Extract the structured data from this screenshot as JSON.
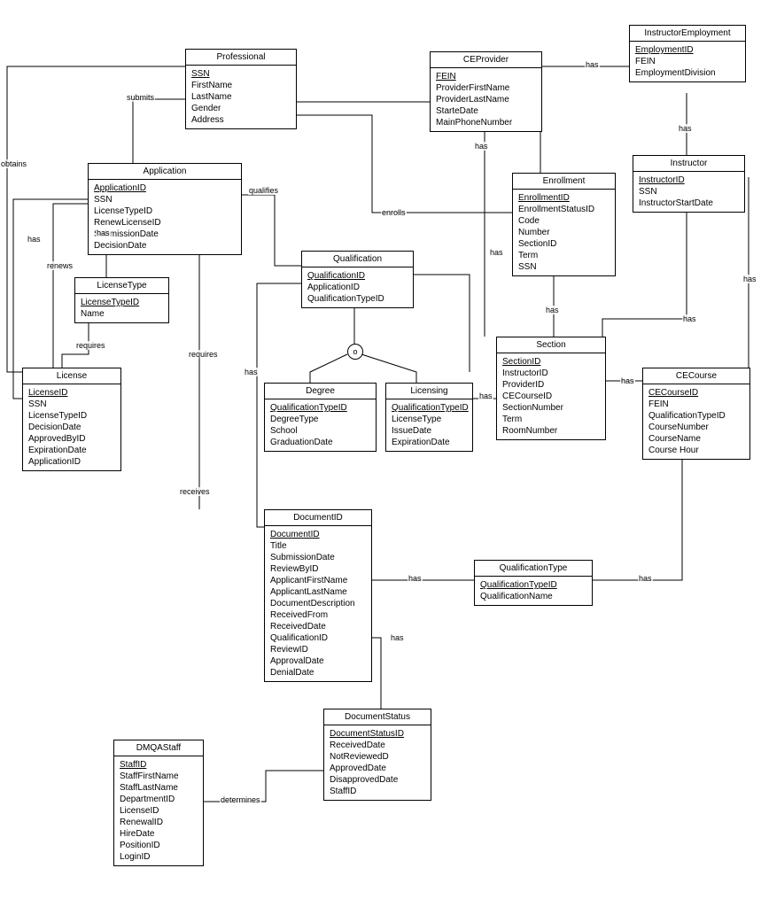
{
  "entities": {
    "professional": {
      "title": "Professional",
      "pk": "SSN",
      "attrs": [
        "FirstName",
        "LastName",
        "Gender",
        "Address"
      ]
    },
    "ceprovider": {
      "title": "CEProvider",
      "pk": "FEIN",
      "attrs": [
        "ProviderFirstName",
        "ProviderLastName",
        "StarteDate",
        "MainPhoneNumber"
      ]
    },
    "instructoremployment": {
      "title": "InstructorEmployment",
      "pk": "EmploymentID",
      "attrs": [
        "FEIN",
        "EmploymentDivision"
      ]
    },
    "application": {
      "title": "Application",
      "pk": "ApplicationID",
      "attrs": [
        "SSN",
        "LicenseTypeID",
        "RenewLicenseID",
        "SubmissionDate",
        "DecisionDate"
      ]
    },
    "enrollment": {
      "title": "Enrollment",
      "pk": "EnrollmentID",
      "attrs": [
        "EnrollmentStatusID",
        "Code",
        "Number",
        "SectionID",
        "Term",
        "SSN"
      ]
    },
    "instructor": {
      "title": "Instructor",
      "pk": "InstructorID",
      "attrs": [
        "SSN",
        "InstructorStartDate"
      ]
    },
    "licensetype": {
      "title": "LicenseType",
      "pk": "LicenseTypeID",
      "attrs": [
        "Name"
      ]
    },
    "qualification": {
      "title": "Qualification",
      "pk": "QualificationID",
      "attrs": [
        "ApplicationID",
        "QualificationTypeID"
      ]
    },
    "section": {
      "title": "Section",
      "pk": "SectionID",
      "attrs": [
        "InstructorID",
        "ProviderID",
        "CECourseID",
        "SectionNumber",
        "Term",
        "RoomNumber"
      ]
    },
    "license": {
      "title": "License",
      "pk": "LicenseID",
      "attrs": [
        "SSN",
        "LicenseTypeID",
        "DecisionDate",
        "ApprovedByID",
        "ExpirationDate",
        "ApplicationID"
      ]
    },
    "degree": {
      "title": "Degree",
      "pk": "QualificationTypeID",
      "attrs": [
        "DegreeType",
        "School",
        "GraduationDate"
      ]
    },
    "licensing": {
      "title": "Licensing",
      "pk": "QualificationTypeID",
      "attrs": [
        "LicenseType",
        "IssueDate",
        "ExpirationDate"
      ]
    },
    "cecourse": {
      "title": "CECourse",
      "pk": "CECourseID",
      "attrs": [
        "FEIN",
        "QualificationTypeID",
        "CourseNumber",
        "CourseName",
        "Course Hour"
      ]
    },
    "documentid": {
      "title": "DocumentID",
      "pk": "DocumentID",
      "attrs": [
        "Title",
        "SubmissionDate",
        "ReviewByID",
        "ApplicantFirstName",
        "ApplicantLastName",
        "DocumentDescription",
        "ReceivedFrom",
        "ReceivedDate",
        "QualificationID",
        "ReviewID",
        "ApprovalDate",
        "DenialDate"
      ]
    },
    "qualificationtype": {
      "title": "QualificationType",
      "pk": "QualificationTypeID",
      "attrs": [
        "QualificationName"
      ]
    },
    "dmqastaff": {
      "title": "DMQAStaff",
      "pk": "StaffID",
      "attrs": [
        "StaffFirstName",
        "StaffLastName",
        "DepartmentID",
        "LicenseID",
        "RenewalID",
        "HireDate",
        "PositionID",
        "LoginID"
      ]
    },
    "documentstatus": {
      "title": "DocumentStatus",
      "pk": "DocumentStatusID",
      "attrs": [
        "ReceivedDate",
        "NotReviewedD",
        "ApprovedDate",
        "DisapprovedDate",
        "StaffID"
      ]
    }
  },
  "labels": {
    "submits": "submits",
    "obtains": "obtains",
    "has": "has",
    "renews": "renews",
    "requires": "requires",
    "qualifies": "qualifies",
    "enrolls": "enrolls",
    "receives": "receives",
    "determines": "determines",
    "o": "o"
  }
}
